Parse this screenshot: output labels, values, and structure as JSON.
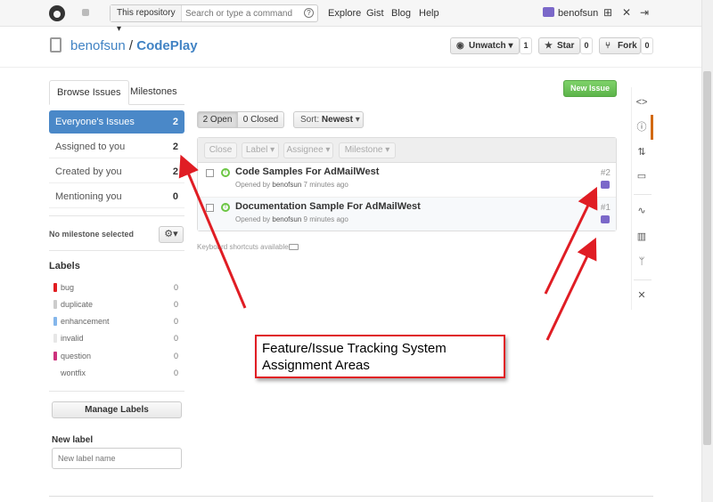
{
  "header": {
    "search_scope": "This repository",
    "search_placeholder": "Search or type a command",
    "help_glyph": "?",
    "nav": [
      "Explore",
      "Gist",
      "Blog",
      "Help"
    ],
    "username": "benofsun",
    "icons": [
      "github-logo-icon",
      "notifications-icon",
      "new-repo-icon",
      "settings-tools-icon",
      "sign-out-icon"
    ]
  },
  "repo": {
    "owner": "benofsun",
    "separator": "/",
    "name": "CodePlay",
    "unwatch_label": "Unwatch",
    "watch_count": "1",
    "star_label": "Star",
    "star_count": "0",
    "fork_label": "Fork",
    "fork_count": "0"
  },
  "tabs": {
    "browse": "Browse Issues",
    "milestones": "Milestones",
    "new_issue": "New Issue"
  },
  "filters": [
    {
      "label": "Everyone's Issues",
      "count": "2"
    },
    {
      "label": "Assigned to you",
      "count": "2"
    },
    {
      "label": "Created by you",
      "count": "2"
    },
    {
      "label": "Mentioning you",
      "count": "0"
    }
  ],
  "milestone": {
    "label": "No milestone selected"
  },
  "labels": {
    "heading": "Labels",
    "items": [
      {
        "name": "bug",
        "count": "0",
        "color": "#e11d21"
      },
      {
        "name": "duplicate",
        "count": "0",
        "color": "#cccccc"
      },
      {
        "name": "enhancement",
        "count": "0",
        "color": "#84b6eb"
      },
      {
        "name": "invalid",
        "count": "0",
        "color": "#e6e6e6"
      },
      {
        "name": "question",
        "count": "0",
        "color": "#cc317c"
      },
      {
        "name": "wontfix",
        "count": "0",
        "color": "#ffffff"
      }
    ],
    "manage_button": "Manage Labels",
    "new_label_heading": "New label",
    "new_label_placeholder": "New label name"
  },
  "issues_toolbar": {
    "open": "2 Open",
    "closed": "0 Closed",
    "sort_prefix": "Sort:",
    "sort_value": "Newest",
    "actions": [
      "Close",
      "Label",
      "Assignee",
      "Milestone"
    ]
  },
  "issues": [
    {
      "title": "Code Samples For AdMailWest",
      "opened_prefix": "Opened by",
      "user": "benofsun",
      "ago": "7 minutes ago",
      "number": "#2"
    },
    {
      "title": "Documentation Sample For AdMailWest",
      "opened_prefix": "Opened by",
      "user": "benofsun",
      "ago": "9 minutes ago",
      "number": "#1"
    }
  ],
  "keyboard_hint": "Keyboard shortcuts available",
  "annotation": {
    "line1": "Feature/Issue Tracking System",
    "line2": "Assignment Areas",
    "color": "#e01d24"
  },
  "colors": {
    "link": "#4183c4",
    "selected_filter": "#4a88c8",
    "new_issue_green": "#6cc644",
    "active_tab_marker": "#d26911"
  }
}
